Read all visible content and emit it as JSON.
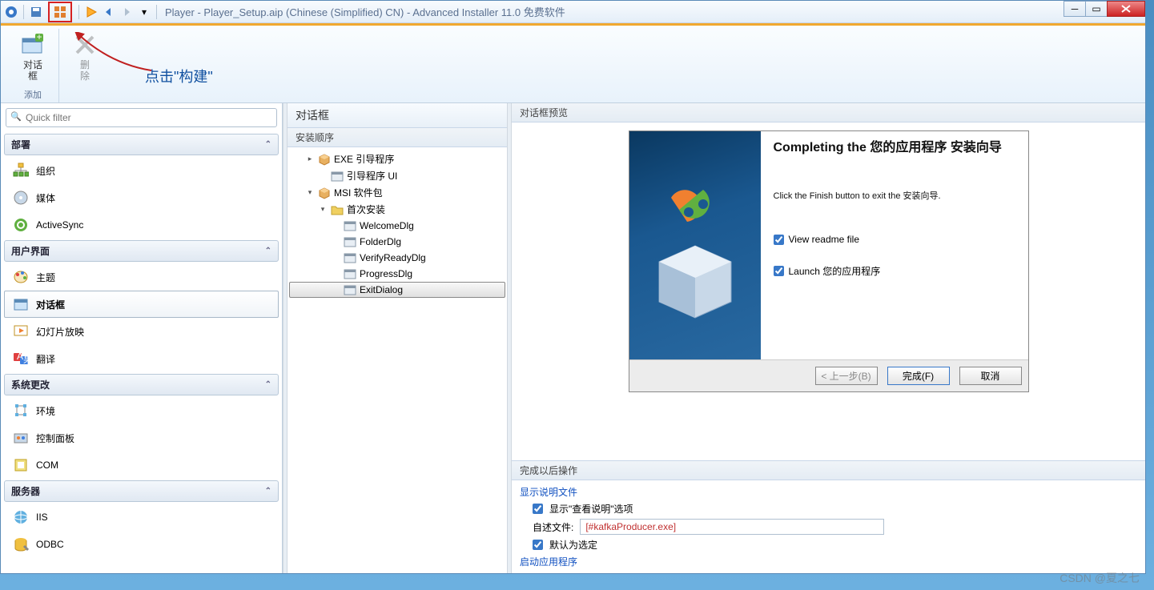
{
  "title": "Player - Player_Setup.aip (Chinese (Simplified) CN) - Advanced Installer 11.0 免费软件",
  "annotation": "点击\"构建\"",
  "ribbon": {
    "dialog_label": "对话\n框",
    "delete_label": "删\n除",
    "add_group": "添加"
  },
  "filter_placeholder": "Quick filter",
  "categories": [
    {
      "label": "部署",
      "items": [
        {
          "icon": "org",
          "label": "组织"
        },
        {
          "icon": "media",
          "label": "媒体"
        },
        {
          "icon": "sync",
          "label": "ActiveSync"
        }
      ]
    },
    {
      "label": "用户界面",
      "items": [
        {
          "icon": "theme",
          "label": "主题"
        },
        {
          "icon": "dialog",
          "label": "对话框",
          "selected": true
        },
        {
          "icon": "slide",
          "label": "幻灯片放映"
        },
        {
          "icon": "translate",
          "label": "翻译"
        }
      ]
    },
    {
      "label": "系统更改",
      "items": [
        {
          "icon": "env",
          "label": "环境"
        },
        {
          "icon": "cpl",
          "label": "控制面板"
        },
        {
          "icon": "com",
          "label": "COM"
        }
      ]
    },
    {
      "label": "服务器",
      "items": [
        {
          "icon": "iis",
          "label": "IIS"
        },
        {
          "icon": "odbc",
          "label": "ODBC"
        }
      ]
    }
  ],
  "mid": {
    "title": "对话框",
    "subtitle": "安装顺序",
    "tree": [
      {
        "level": 0,
        "exp": "▸",
        "icon": "box",
        "label": "EXE 引导程序"
      },
      {
        "level": 1,
        "exp": "",
        "icon": "dlg",
        "label": "引导程序 UI"
      },
      {
        "level": 0,
        "exp": "▾",
        "icon": "box",
        "label": "MSI 软件包"
      },
      {
        "level": 1,
        "exp": "▾",
        "icon": "folder",
        "label": "首次安装"
      },
      {
        "level": 2,
        "exp": "",
        "icon": "dlg",
        "label": "WelcomeDlg"
      },
      {
        "level": 2,
        "exp": "",
        "icon": "dlg",
        "label": "FolderDlg"
      },
      {
        "level": 2,
        "exp": "",
        "icon": "dlg",
        "label": "VerifyReadyDlg"
      },
      {
        "level": 2,
        "exp": "",
        "icon": "dlg",
        "label": "ProgressDlg"
      },
      {
        "level": 2,
        "exp": "",
        "icon": "dlg",
        "label": "ExitDialog",
        "selected": true
      }
    ]
  },
  "preview": {
    "title": "对话框预览",
    "heading": "Completing the 您的应用程序 安装向导",
    "text": "Click the Finish button to exit the 安装向导.",
    "check1": "View readme file",
    "check2": "Launch 您的应用程序",
    "btn_back": "< 上一步(B)",
    "btn_finish": "完成(F)",
    "btn_cancel": "取消"
  },
  "post": {
    "title": "完成以后操作",
    "section1": "显示说明文件",
    "show_readme_option": "显示\"查看说明\"选项",
    "readme_file_label": "自述文件:",
    "readme_file_value": "[#kafkaProducer.exe]",
    "default_selected": "默认为选定",
    "section2": "启动应用程序"
  },
  "watermark": "CSDN @夏之七"
}
